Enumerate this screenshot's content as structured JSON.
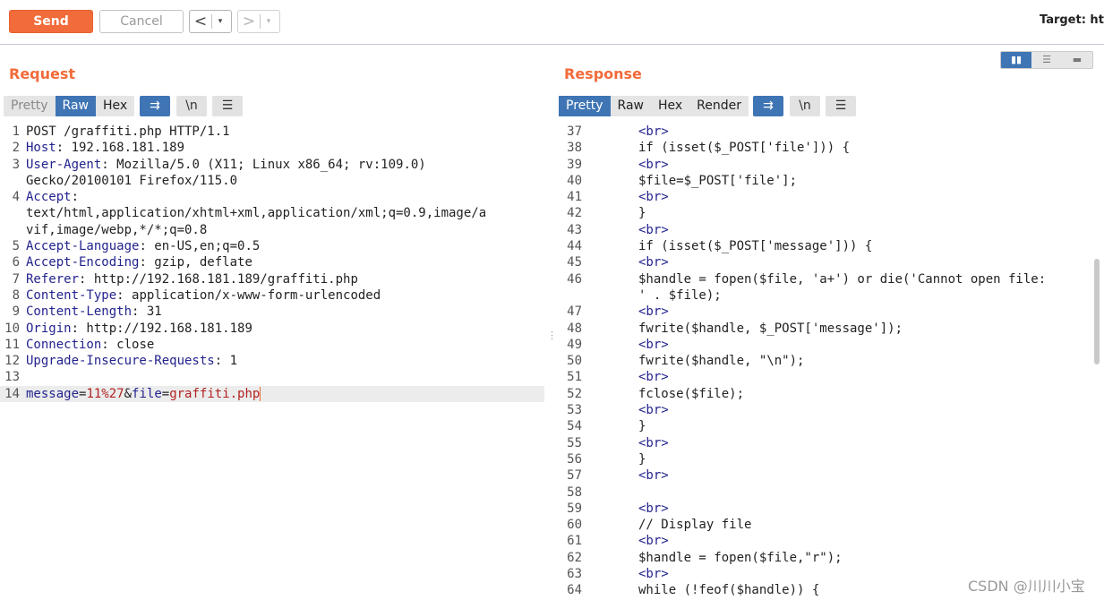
{
  "toolbar": {
    "send_label": "Send",
    "cancel_label": "Cancel",
    "back_arrow": "<",
    "forward_arrow": ">",
    "dropdown_glyph": "▾",
    "target_label": "Target: htt"
  },
  "request": {
    "title": "Request",
    "tabs": [
      "Pretty",
      "Raw",
      "Hex"
    ],
    "active_tab": "Raw",
    "icons": {
      "wrap": "⇉",
      "newline": "\\n",
      "menu": "☰"
    },
    "lines": [
      {
        "n": "1",
        "parts": [
          [
            "POST /graffiti.php HTTP/1.1",
            ""
          ]
        ]
      },
      {
        "n": "2",
        "parts": [
          [
            "Host",
            "key"
          ],
          [
            ": 192.168.181.189",
            ""
          ]
        ]
      },
      {
        "n": "3",
        "parts": [
          [
            "User-Agent",
            "key"
          ],
          [
            ": Mozilla/5.0 (X11; Linux x86_64; rv:109.0)",
            ""
          ]
        ]
      },
      {
        "n": "",
        "parts": [
          [
            "Gecko/20100101 Firefox/115.0",
            ""
          ]
        ]
      },
      {
        "n": "4",
        "parts": [
          [
            "Accept",
            "key"
          ],
          [
            ":",
            ""
          ]
        ]
      },
      {
        "n": "",
        "parts": [
          [
            "text/html,application/xhtml+xml,application/xml;q=0.9,image/a",
            ""
          ]
        ]
      },
      {
        "n": "",
        "parts": [
          [
            "vif,image/webp,*/*;q=0.8",
            ""
          ]
        ]
      },
      {
        "n": "5",
        "parts": [
          [
            "Accept-Language",
            "key"
          ],
          [
            ": en-US,en;q=0.5",
            ""
          ]
        ]
      },
      {
        "n": "6",
        "parts": [
          [
            "Accept-Encoding",
            "key"
          ],
          [
            ": gzip, deflate",
            ""
          ]
        ]
      },
      {
        "n": "7",
        "parts": [
          [
            "Referer",
            "key"
          ],
          [
            ": http://192.168.181.189/graffiti.php",
            ""
          ]
        ]
      },
      {
        "n": "8",
        "parts": [
          [
            "Content-Type",
            "key"
          ],
          [
            ": application/x-www-form-urlencoded",
            ""
          ]
        ]
      },
      {
        "n": "9",
        "parts": [
          [
            "Content-Length",
            "key"
          ],
          [
            ": 31",
            ""
          ]
        ]
      },
      {
        "n": "10",
        "parts": [
          [
            "Origin",
            "key"
          ],
          [
            ": http://192.168.181.189",
            ""
          ]
        ]
      },
      {
        "n": "11",
        "parts": [
          [
            "Connection",
            "key"
          ],
          [
            ": close",
            ""
          ]
        ]
      },
      {
        "n": "12",
        "parts": [
          [
            "Upgrade-Insecure-Requests",
            "key"
          ],
          [
            ": 1",
            ""
          ]
        ]
      },
      {
        "n": "13",
        "parts": []
      },
      {
        "n": "14",
        "parts": [
          [
            "message",
            "key"
          ],
          [
            "=",
            ""
          ],
          [
            "11%27",
            "val"
          ],
          [
            "&",
            ""
          ],
          [
            "file",
            "key"
          ],
          [
            "=",
            ""
          ],
          [
            "graffiti.php",
            "val"
          ]
        ],
        "current": true
      }
    ]
  },
  "response": {
    "title": "Response",
    "tabs": [
      "Pretty",
      "Raw",
      "Hex",
      "Render"
    ],
    "active_tab": "Pretty",
    "icons": {
      "wrap": "⇉",
      "newline": "\\n",
      "menu": "☰"
    },
    "layout_modes": [
      "▮▮",
      "☰",
      "▬"
    ],
    "lines": [
      {
        "n": "37",
        "parts": [
          [
            "<br>",
            "tag"
          ]
        ]
      },
      {
        "n": "38",
        "parts": [
          [
            "if (isset($_POST['file'])) {",
            ""
          ]
        ]
      },
      {
        "n": "39",
        "parts": [
          [
            "<br>",
            "tag"
          ]
        ]
      },
      {
        "n": "40",
        "parts": [
          [
            "$file=$_POST['file'];",
            ""
          ]
        ]
      },
      {
        "n": "41",
        "parts": [
          [
            "<br>",
            "tag"
          ]
        ]
      },
      {
        "n": "42",
        "parts": [
          [
            "}",
            ""
          ]
        ]
      },
      {
        "n": "43",
        "parts": [
          [
            "<br>",
            "tag"
          ]
        ]
      },
      {
        "n": "44",
        "parts": [
          [
            "if (isset($_POST['message'])) {",
            ""
          ]
        ]
      },
      {
        "n": "45",
        "parts": [
          [
            "<br>",
            "tag"
          ]
        ]
      },
      {
        "n": "46",
        "parts": [
          [
            "$handle = fopen($file, 'a+') or die('Cannot open file:",
            ""
          ]
        ]
      },
      {
        "n": "",
        "parts": [
          [
            "' . $file);",
            ""
          ]
        ]
      },
      {
        "n": "47",
        "parts": [
          [
            "<br>",
            "tag"
          ]
        ]
      },
      {
        "n": "48",
        "parts": [
          [
            "fwrite($handle, $_POST['message']);",
            ""
          ]
        ]
      },
      {
        "n": "49",
        "parts": [
          [
            "<br>",
            "tag"
          ]
        ]
      },
      {
        "n": "50",
        "parts": [
          [
            "fwrite($handle, \"\\n\");",
            ""
          ]
        ]
      },
      {
        "n": "51",
        "parts": [
          [
            "<br>",
            "tag"
          ]
        ]
      },
      {
        "n": "52",
        "parts": [
          [
            "fclose($file);",
            ""
          ]
        ]
      },
      {
        "n": "53",
        "parts": [
          [
            "<br>",
            "tag"
          ]
        ]
      },
      {
        "n": "54",
        "parts": [
          [
            "}",
            ""
          ]
        ]
      },
      {
        "n": "55",
        "parts": [
          [
            "<br>",
            "tag"
          ]
        ]
      },
      {
        "n": "56",
        "parts": [
          [
            "}",
            ""
          ]
        ]
      },
      {
        "n": "57",
        "parts": [
          [
            "<br>",
            "tag"
          ]
        ]
      },
      {
        "n": "58",
        "parts": []
      },
      {
        "n": "59",
        "parts": [
          [
            "<br>",
            "tag"
          ]
        ]
      },
      {
        "n": "60",
        "parts": [
          [
            "// Display file",
            ""
          ]
        ]
      },
      {
        "n": "61",
        "parts": [
          [
            "<br>",
            "tag"
          ]
        ]
      },
      {
        "n": "62",
        "parts": [
          [
            "$handle = fopen($file,\"r\");",
            ""
          ]
        ]
      },
      {
        "n": "63",
        "parts": [
          [
            "<br>",
            "tag"
          ]
        ]
      },
      {
        "n": "64",
        "parts": [
          [
            "while (!feof($handle)) {",
            ""
          ]
        ]
      }
    ]
  },
  "watermark": "CSDN @川川小宝",
  "colors": {
    "accent": "#f26b3a",
    "active_tab": "#3f75b4",
    "key": "#23238e",
    "value": "#b22222"
  }
}
